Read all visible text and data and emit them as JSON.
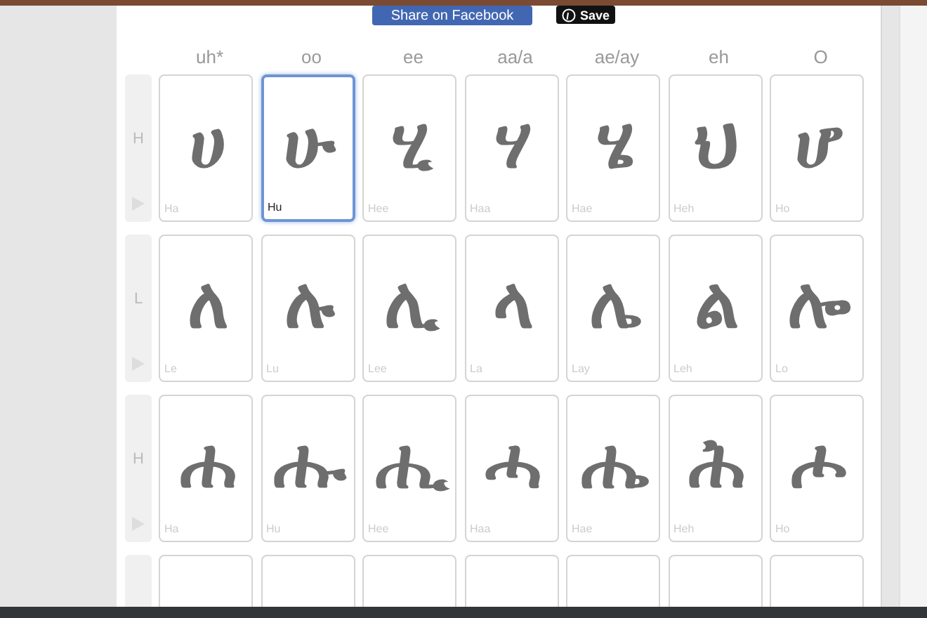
{
  "share_buttons": [
    {
      "kind": "facebook",
      "label": "Share on Facebook"
    },
    {
      "kind": "pinterest",
      "label": "Save"
    }
  ],
  "columns": [
    "uh*",
    "oo",
    "ee",
    "aa/a",
    "ae/ay",
    "eh",
    "O"
  ],
  "rows": [
    {
      "letter": "H",
      "cards": [
        {
          "glyph": "ሀ",
          "label": "Ha",
          "selected": false
        },
        {
          "glyph": "ሁ",
          "label": "Hu",
          "selected": true
        },
        {
          "glyph": "ሂ",
          "label": "Hee",
          "selected": false
        },
        {
          "glyph": "ሃ",
          "label": "Haa",
          "selected": false
        },
        {
          "glyph": "ሄ",
          "label": "Hae",
          "selected": false
        },
        {
          "glyph": "ህ",
          "label": "Heh",
          "selected": false
        },
        {
          "glyph": "ሆ",
          "label": "Ho",
          "selected": false
        }
      ]
    },
    {
      "letter": "L",
      "cards": [
        {
          "glyph": "ለ",
          "label": "Le",
          "selected": false
        },
        {
          "glyph": "ሉ",
          "label": "Lu",
          "selected": false
        },
        {
          "glyph": "ሊ",
          "label": "Lee",
          "selected": false
        },
        {
          "glyph": "ላ",
          "label": "La",
          "selected": false
        },
        {
          "glyph": "ሌ",
          "label": "Lay",
          "selected": false
        },
        {
          "glyph": "ል",
          "label": "Leh",
          "selected": false
        },
        {
          "glyph": "ሎ",
          "label": "Lo",
          "selected": false
        }
      ]
    },
    {
      "letter": "H",
      "cards": [
        {
          "glyph": "ሐ",
          "label": "Ha",
          "selected": false
        },
        {
          "glyph": "ሑ",
          "label": "Hu",
          "selected": false
        },
        {
          "glyph": "ሒ",
          "label": "Hee",
          "selected": false
        },
        {
          "glyph": "ሓ",
          "label": "Haa",
          "selected": false
        },
        {
          "glyph": "ሔ",
          "label": "Hae",
          "selected": false
        },
        {
          "glyph": "ሕ",
          "label": "Heh",
          "selected": false
        },
        {
          "glyph": "ሖ",
          "label": "Ho",
          "selected": false
        }
      ]
    },
    {
      "cards": [
        {
          "selected": false
        },
        {
          "selected": false
        },
        {
          "selected": false
        },
        {
          "selected": false
        },
        {
          "selected": false
        },
        {
          "selected": false
        },
        {
          "selected": false
        }
      ]
    }
  ]
}
